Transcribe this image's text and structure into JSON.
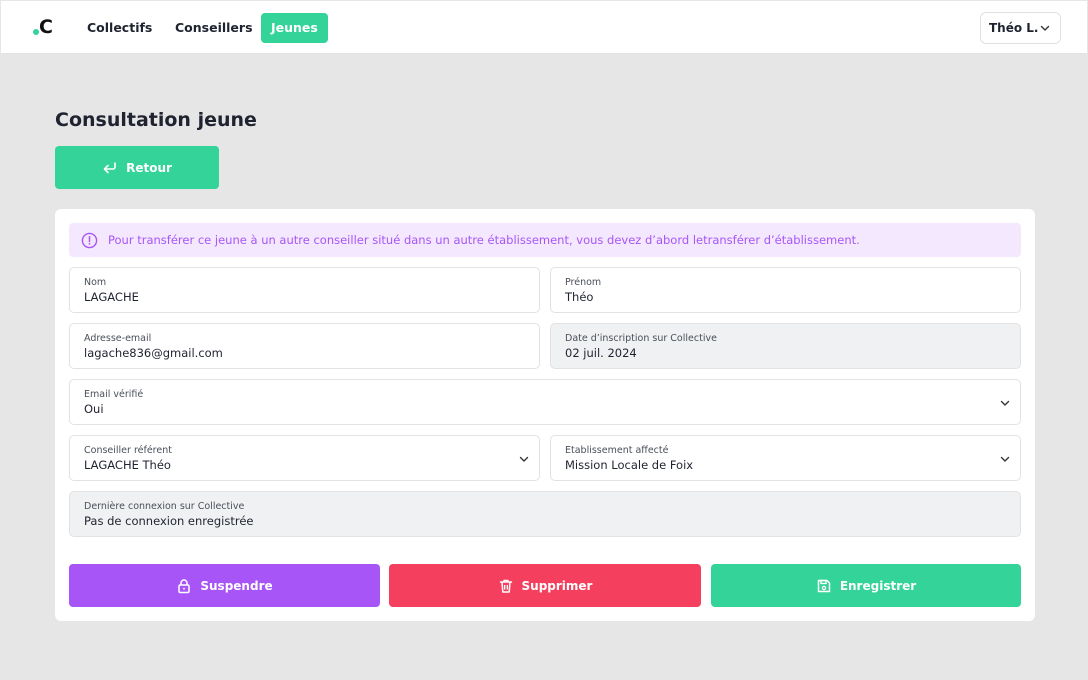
{
  "nav": {
    "logo_letter": "C",
    "items": [
      {
        "label": "Collectifs",
        "active": false
      },
      {
        "label": "Conseillers",
        "active": false
      },
      {
        "label": "Jeunes",
        "active": true
      }
    ],
    "user": "Théo L."
  },
  "page": {
    "title": "Consultation jeune",
    "back_label": "Retour"
  },
  "alert": {
    "text": "Pour transférer ce jeune à un autre conseiller situé dans un autre établissement, vous devez d’abord letransférer d’établissement."
  },
  "fields": {
    "nom": {
      "label": "Nom",
      "value": "LAGACHE"
    },
    "prenom": {
      "label": "Prénom",
      "value": "Théo"
    },
    "email": {
      "label": "Adresse-email",
      "value": "lagache836@gmail.com"
    },
    "inscription": {
      "label": "Date d’inscription sur Collective",
      "value": "02 juil. 2024"
    },
    "email_verifie": {
      "label": "Email vérifié",
      "value": "Oui"
    },
    "conseiller": {
      "label": "Conseiller référent",
      "value": "LAGACHE Théo"
    },
    "etablissement": {
      "label": "Etablissement affecté",
      "value": "Mission Locale de Foix"
    },
    "derniere_connexion": {
      "label": "Dernière connexion sur Collective",
      "value": "Pas de connexion enregistrée"
    }
  },
  "actions": {
    "suspend": "Suspendre",
    "delete": "Supprimer",
    "save": "Enregistrer"
  },
  "colors": {
    "primary": "#34d399",
    "purple": "#a855f7",
    "danger": "#f43f5e",
    "alert_bg": "#f3e8fd"
  }
}
